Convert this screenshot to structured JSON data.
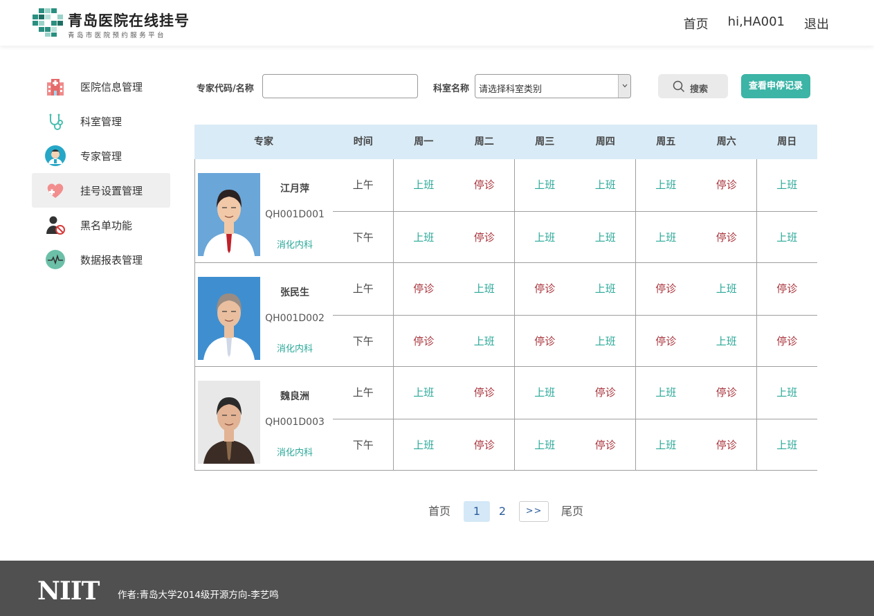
{
  "header": {
    "title": "青岛医院在线挂号",
    "subtitle": "青岛市医院预约服务平台",
    "nav": [
      "首页",
      "hi,HA001",
      "退出"
    ]
  },
  "sidebar": {
    "items": [
      {
        "label": "医院信息管理",
        "icon": "hospital-icon"
      },
      {
        "label": "科室管理",
        "icon": "stethoscope-icon"
      },
      {
        "label": "专家管理",
        "icon": "doctor-icon"
      },
      {
        "label": "挂号设置管理",
        "icon": "heart-plus-icon",
        "active": true
      },
      {
        "label": "黑名单功能",
        "icon": "user-block-icon"
      },
      {
        "label": "数据报表管理",
        "icon": "pulse-chart-icon"
      }
    ]
  },
  "search": {
    "code_label": "专家代码/名称",
    "code_value": "",
    "dept_label": "科室名称",
    "dept_selected": "请选择科室类别",
    "search_label": "搜索",
    "record_label": "查看申停记录"
  },
  "table": {
    "headers": [
      "专家",
      "时间",
      "周一",
      "周二",
      "周三",
      "周四",
      "周五",
      "周六",
      "周日"
    ],
    "doctors": [
      {
        "name": "江月萍",
        "code": "QH001D001",
        "dept": "消化内科",
        "am": {
          "time": "上午",
          "days": [
            "上班",
            "停诊",
            "上班",
            "上班",
            "上班",
            "停诊",
            "上班"
          ]
        },
        "pm": {
          "time": "下午",
          "days": [
            "上班",
            "停诊",
            "上班",
            "上班",
            "上班",
            "停诊",
            "上班"
          ]
        }
      },
      {
        "name": "张民生",
        "code": "QH001D002",
        "dept": "消化内科",
        "am": {
          "time": "上午",
          "days": [
            "停诊",
            "上班",
            "停诊",
            "上班",
            "停诊",
            "上班",
            "停诊"
          ]
        },
        "pm": {
          "time": "下午",
          "days": [
            "停诊",
            "上班",
            "停诊",
            "上班",
            "停诊",
            "上班",
            "停诊"
          ]
        }
      },
      {
        "name": "魏良洲",
        "code": "QH001D003",
        "dept": "消化内科",
        "am": {
          "time": "上午",
          "days": [
            "上班",
            "停诊",
            "上班",
            "停诊",
            "上班",
            "停诊",
            "上班"
          ]
        },
        "pm": {
          "time": "下午",
          "days": [
            "上班",
            "停诊",
            "上班",
            "停诊",
            "上班",
            "停诊",
            "上班"
          ]
        }
      }
    ]
  },
  "pagination": {
    "first": "首页",
    "pages": [
      "1",
      "2"
    ],
    "current": "1",
    "next": ">>",
    "last": "尾页"
  },
  "footer": {
    "logo_text": "NIIT",
    "author": "作者:青岛大学2014级开源方向-李艺鸣"
  },
  "colors": {
    "accent": "#3cb4a6",
    "on_duty": "#2aa898",
    "off_duty": "#a8323a",
    "table_header": "#d9ebf6",
    "footer": "#505050"
  }
}
